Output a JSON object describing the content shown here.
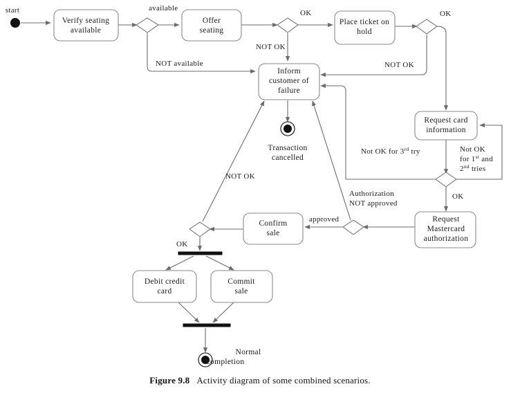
{
  "figure": {
    "caption_label": "Figure 9.8",
    "caption_text": "Activity diagram of some combined scenarios.",
    "diagram_type": "UML activity diagram"
  },
  "nodes": {
    "start_label": "start",
    "verify_seating": "Verify seating\navailable",
    "verify_seating_line1": "Verify seating",
    "verify_seating_line2": "available",
    "offer_seating_line1": "Offer",
    "offer_seating_line2": "seating",
    "place_ticket_line1": "Place ticket on",
    "place_ticket_line2": "hold",
    "inform_failure_line1": "Inform",
    "inform_failure_line2": "customer of",
    "inform_failure_line3": "failure",
    "transaction_cancelled_line1": "Transaction",
    "transaction_cancelled_line2": "cancelled",
    "request_card_line1": "Request card",
    "request_card_line2": "information",
    "request_mastercard_line1": "Request",
    "request_mastercard_line2": "Mastercard",
    "request_mastercard_line3": "authorization",
    "confirm_sale_line1": "Confirm",
    "confirm_sale_line2": "sale",
    "debit_credit_line1": "Debit credit",
    "debit_credit_line2": "card",
    "commit_sale_line1": "Commit",
    "commit_sale_line2": "sale",
    "normal_completion_line1": "Normal",
    "normal_completion_line2": "completion"
  },
  "edge_labels": {
    "available": "available",
    "not_available": "NOT available",
    "ok_after_offer": "OK",
    "not_ok_after_offer": "NOT OK",
    "ok_after_hold": "OK",
    "not_ok_after_hold": "NOT OK",
    "not_ok_third_try": "Not OK for 3",
    "not_ok_third_try_sup": "rd",
    "not_ok_third_try_tail": " try",
    "not_ok_retry_line1": "Not OK",
    "not_ok_retry_line2_pre": "for 1",
    "not_ok_retry_line2_sup": "st",
    "not_ok_retry_line2_post": " and",
    "not_ok_retry_line3_sup": "nd",
    "not_ok_retry_line3_post": " tries",
    "ok_after_card": "OK",
    "approved": "approved",
    "authorization_not_approved_line1": "Authorization",
    "authorization_not_approved_line2": "NOT approved",
    "not_ok_after_confirm": "NOT OK",
    "ok_after_confirm": "OK"
  },
  "colors": {
    "edge": "#6b6b6b",
    "node_stroke": "#8a8a8a",
    "node_fill": "#ffffff",
    "text": "#1a1a1a",
    "bar": "#111111",
    "background": "#ffffff"
  }
}
